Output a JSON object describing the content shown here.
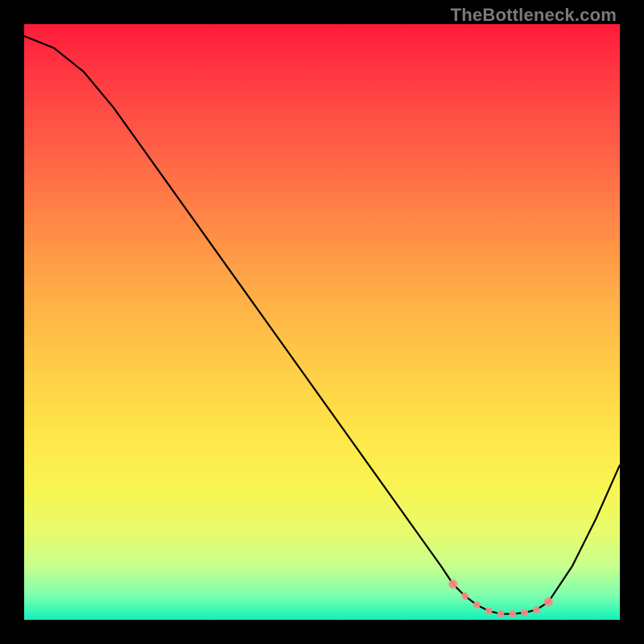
{
  "watermark": "TheBottleneck.com",
  "chart_data": {
    "type": "line",
    "title": "",
    "xlabel": "",
    "ylabel": "",
    "ylim": [
      0,
      100
    ],
    "x": [
      0,
      5,
      10,
      15,
      20,
      25,
      30,
      35,
      40,
      45,
      50,
      55,
      60,
      65,
      70,
      72,
      74,
      76,
      78,
      80,
      82,
      84,
      86,
      88,
      92,
      96,
      100
    ],
    "values": [
      98,
      96,
      92,
      86,
      79,
      72,
      65,
      58,
      51,
      44,
      37,
      30,
      23,
      16,
      9,
      6,
      4,
      2.5,
      1.5,
      1,
      1,
      1.2,
      1.7,
      3,
      9,
      17,
      26
    ],
    "gradient_stops": [
      {
        "pos": 0,
        "color": "#ff1a3a"
      },
      {
        "pos": 50,
        "color": "#ffb447"
      },
      {
        "pos": 80,
        "color": "#fef552"
      },
      {
        "pos": 100,
        "color": "#18e8be"
      }
    ],
    "markers_x": [
      72,
      74,
      76,
      78,
      80,
      82,
      84,
      86,
      88
    ],
    "markers_y": [
      6,
      4,
      2.5,
      1.5,
      1,
      1,
      1.2,
      1.7,
      3
    ],
    "annotations": []
  }
}
